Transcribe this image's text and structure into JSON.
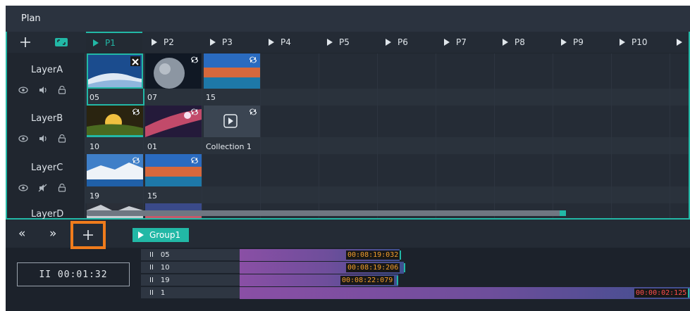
{
  "plan": {
    "title": "Plan"
  },
  "tabs": [
    "P1",
    "P2",
    "P3",
    "P4",
    "P5",
    "P6",
    "P7",
    "P8",
    "P9",
    "P10"
  ],
  "layers": [
    {
      "name": "LayerA",
      "clips": [
        "05",
        "07",
        "15"
      ]
    },
    {
      "name": "LayerB",
      "clips": [
        "10",
        "01",
        "Collection 1"
      ]
    },
    {
      "name": "LayerC",
      "clips": [
        "19",
        "15"
      ]
    },
    {
      "name": "LayerD",
      "clips": []
    }
  ],
  "group": {
    "label": "Group1"
  },
  "timer": {
    "value": "II  00:01:32"
  },
  "tracks": [
    {
      "name": "05",
      "time": "00:08:19:032"
    },
    {
      "name": "10",
      "time": "00:08:19:206"
    },
    {
      "name": "19",
      "time": "00:08:22:079"
    },
    {
      "name": "1",
      "time": "00:00:02:125"
    }
  ],
  "nav": {
    "prev": "«",
    "next": "»"
  },
  "colors": {
    "accent": "#22b8a6",
    "highlight": "#f07c1c",
    "time_text": "#f29d2c",
    "time_alert": "#ff4d4d"
  },
  "icons": [
    "plus-icon",
    "fit-icon",
    "eye-icon",
    "volume-icon",
    "mute-icon",
    "lock-icon",
    "loop-icon",
    "close-icon",
    "play-icon"
  ]
}
